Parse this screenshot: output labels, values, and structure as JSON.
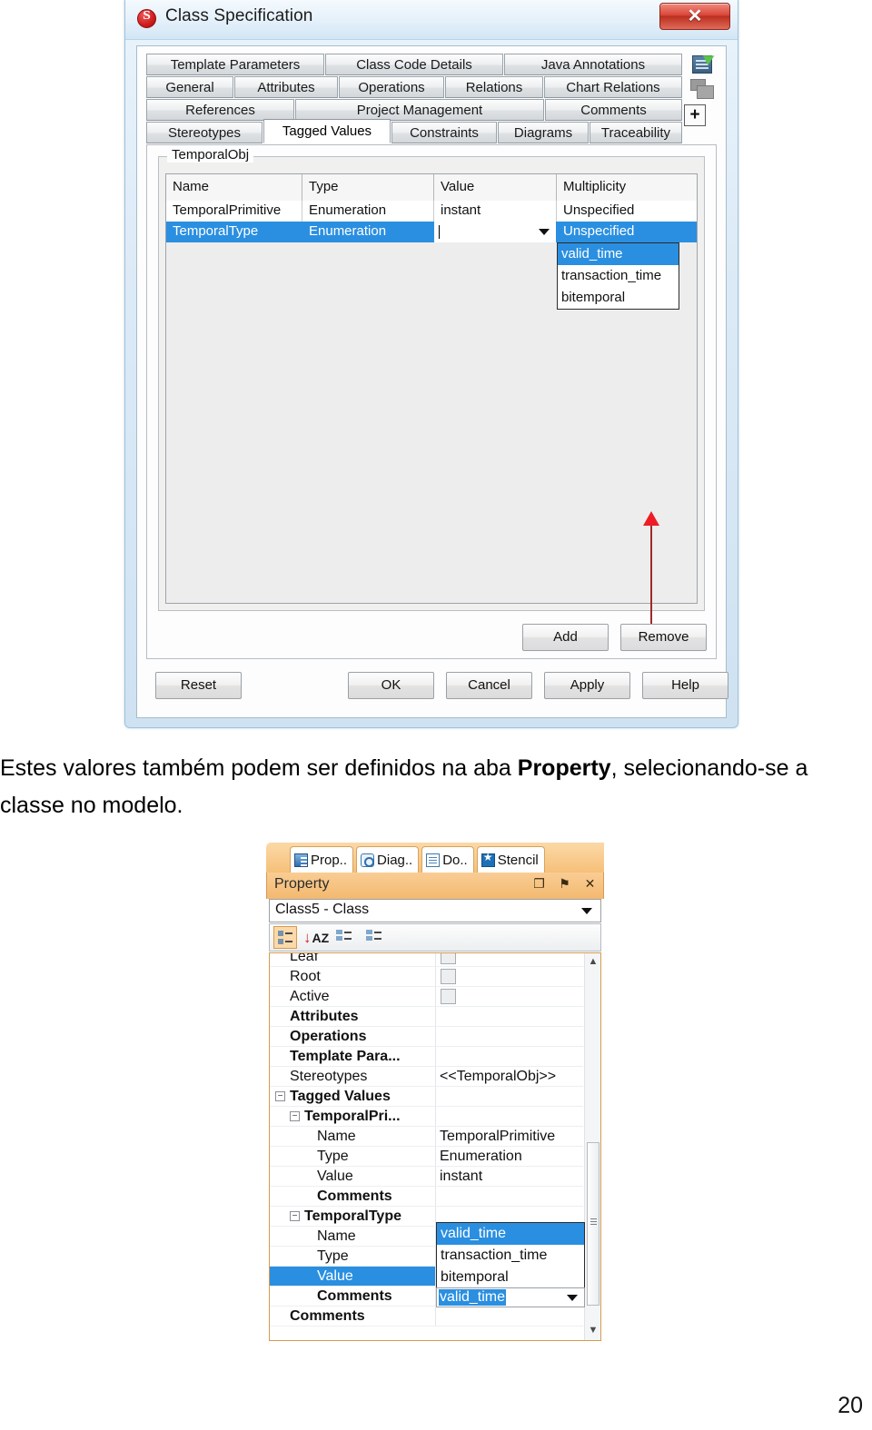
{
  "dialog": {
    "title": "Class Specification",
    "app_icon": "application-icon",
    "close_label": "✕",
    "tab_rows": [
      [
        "Template Parameters",
        "Class Code Details",
        "Java Annotations"
      ],
      [
        "General",
        "Attributes",
        "Operations",
        "Relations",
        "Chart Relations"
      ],
      [
        "References",
        "Project Management",
        "Comments"
      ],
      [
        "Stereotypes",
        "Tagged Values",
        "Constraints",
        "Diagrams",
        "Traceability"
      ]
    ],
    "active_tab": "Tagged Values",
    "side_icons": [
      "code-export-icon",
      "windows-icon",
      "plus-icon"
    ],
    "plus_label": "+",
    "group_label": "TemporalObj",
    "grid": {
      "headers": [
        "Name",
        "Type",
        "Value",
        "Multiplicity"
      ],
      "rows": [
        {
          "name": "TemporalPrimitive",
          "type": "Enumeration",
          "value": "instant",
          "multiplicity": "Unspecified",
          "selected": false
        },
        {
          "name": "TemporalType",
          "type": "Enumeration",
          "value": "",
          "multiplicity": "Unspecified",
          "selected": true
        }
      ]
    },
    "dropdown_options": [
      "valid_time",
      "transaction_time",
      "bitemporal"
    ],
    "dropdown_selected": "valid_time",
    "grid_buttons": [
      "Add",
      "Remove"
    ],
    "footer_buttons": [
      "Reset",
      "OK",
      "Cancel",
      "Apply",
      "Help"
    ]
  },
  "caption": {
    "part1": "Estes valores também podem ser definidos na aba ",
    "bold": "Property",
    "part2": ", selecionando-se a classe no modelo."
  },
  "property_panel": {
    "tabs": [
      {
        "label": "Prop..",
        "icon": "properties-icon"
      },
      {
        "label": "Diag..",
        "icon": "diagram-icon"
      },
      {
        "label": "Do..",
        "icon": "document-icon"
      },
      {
        "label": "Stencil",
        "icon": "stencil-icon"
      }
    ],
    "header_title": "Property",
    "header_icons": [
      "float-icon",
      "pin-icon",
      "close-icon"
    ],
    "float_glyph": "❐",
    "pin_glyph": "⚑",
    "close_glyph": "✕",
    "combo_value": "Class5 - Class",
    "toolbar_icons": [
      "categorized-icon",
      "alphabetical-sort-icon",
      "property-pages-icon",
      "property-pages-alt-icon"
    ],
    "sort_label": "A\nZ",
    "rows": [
      {
        "name": "Leaf",
        "value": "",
        "bold": false,
        "indent": 1,
        "checkbox": true
      },
      {
        "name": "Root",
        "value": "",
        "bold": false,
        "indent": 1,
        "checkbox": true
      },
      {
        "name": "Active",
        "value": "",
        "bold": false,
        "indent": 1,
        "checkbox": true
      },
      {
        "name": "Attributes",
        "value": "",
        "bold": true,
        "indent": 1,
        "checkbox": false
      },
      {
        "name": "Operations",
        "value": "",
        "bold": true,
        "indent": 1,
        "checkbox": false
      },
      {
        "name": "Template Para...",
        "value": "",
        "bold": true,
        "indent": 1,
        "checkbox": false
      },
      {
        "name": "Stereotypes",
        "value": "<<TemporalObj>>",
        "bold": false,
        "indent": 1,
        "checkbox": false
      },
      {
        "name": "Tagged Values",
        "value": "",
        "bold": true,
        "indent": 1,
        "checkbox": false,
        "expander": "1"
      },
      {
        "name": "TemporalPri...",
        "value": "",
        "bold": true,
        "indent": 2,
        "checkbox": false,
        "expander": "2"
      },
      {
        "name": "Name",
        "value": "TemporalPrimitive",
        "bold": false,
        "indent": 3,
        "checkbox": false
      },
      {
        "name": "Type",
        "value": "Enumeration",
        "bold": false,
        "indent": 3,
        "checkbox": false
      },
      {
        "name": "Value",
        "value": "instant",
        "bold": false,
        "indent": 3,
        "checkbox": false
      },
      {
        "name": "Comments",
        "value": "",
        "bold": true,
        "indent": 3,
        "checkbox": false
      },
      {
        "name": "TemporalType",
        "value": "",
        "bold": true,
        "indent": 2,
        "checkbox": false,
        "expander": "2"
      },
      {
        "name": "Name",
        "value": "",
        "bold": false,
        "indent": 3,
        "checkbox": false
      },
      {
        "name": "Type",
        "value": "",
        "bold": false,
        "indent": 3,
        "checkbox": false
      },
      {
        "name": "Value",
        "value": "",
        "bold": false,
        "indent": 3,
        "checkbox": false,
        "selected": true
      },
      {
        "name": "Comments",
        "value": "",
        "bold": true,
        "indent": 3,
        "checkbox": false
      },
      {
        "name": "Comments",
        "value": "",
        "bold": true,
        "indent": 1,
        "checkbox": false
      }
    ],
    "dropdown_options": [
      "valid_time",
      "transaction_time",
      "bitemporal"
    ],
    "dropdown_selected": "valid_time",
    "editor_value": "valid_time",
    "scroll_up_glyph": "▲",
    "scroll_down_glyph": "▼"
  },
  "page_number": "20",
  "colors": {
    "selection_blue": "#2a8fe0",
    "panel_orange": "#f3b96f",
    "annotation_red": "#ee1c25",
    "close_red": "#d9483a"
  }
}
